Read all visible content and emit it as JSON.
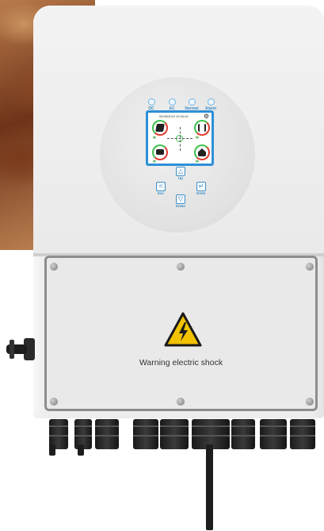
{
  "device": {
    "leds": [
      {
        "label": "DC"
      },
      {
        "label": "AC"
      },
      {
        "label": "Normal"
      },
      {
        "label": "Alarm"
      }
    ],
    "screen": {
      "datetime": "05/28/2019  15:34:40"
    },
    "keys": {
      "up": "Up",
      "down": "Down",
      "esc": "Esc",
      "enter": "Enter"
    },
    "cover": {
      "warning_text": "Warning electric shock"
    }
  },
  "colors": {
    "accent": "#2d8fd8",
    "warning_yellow": "#f2c200",
    "gauge_green": "#3cc04a",
    "gauge_red": "#e23b2c"
  }
}
